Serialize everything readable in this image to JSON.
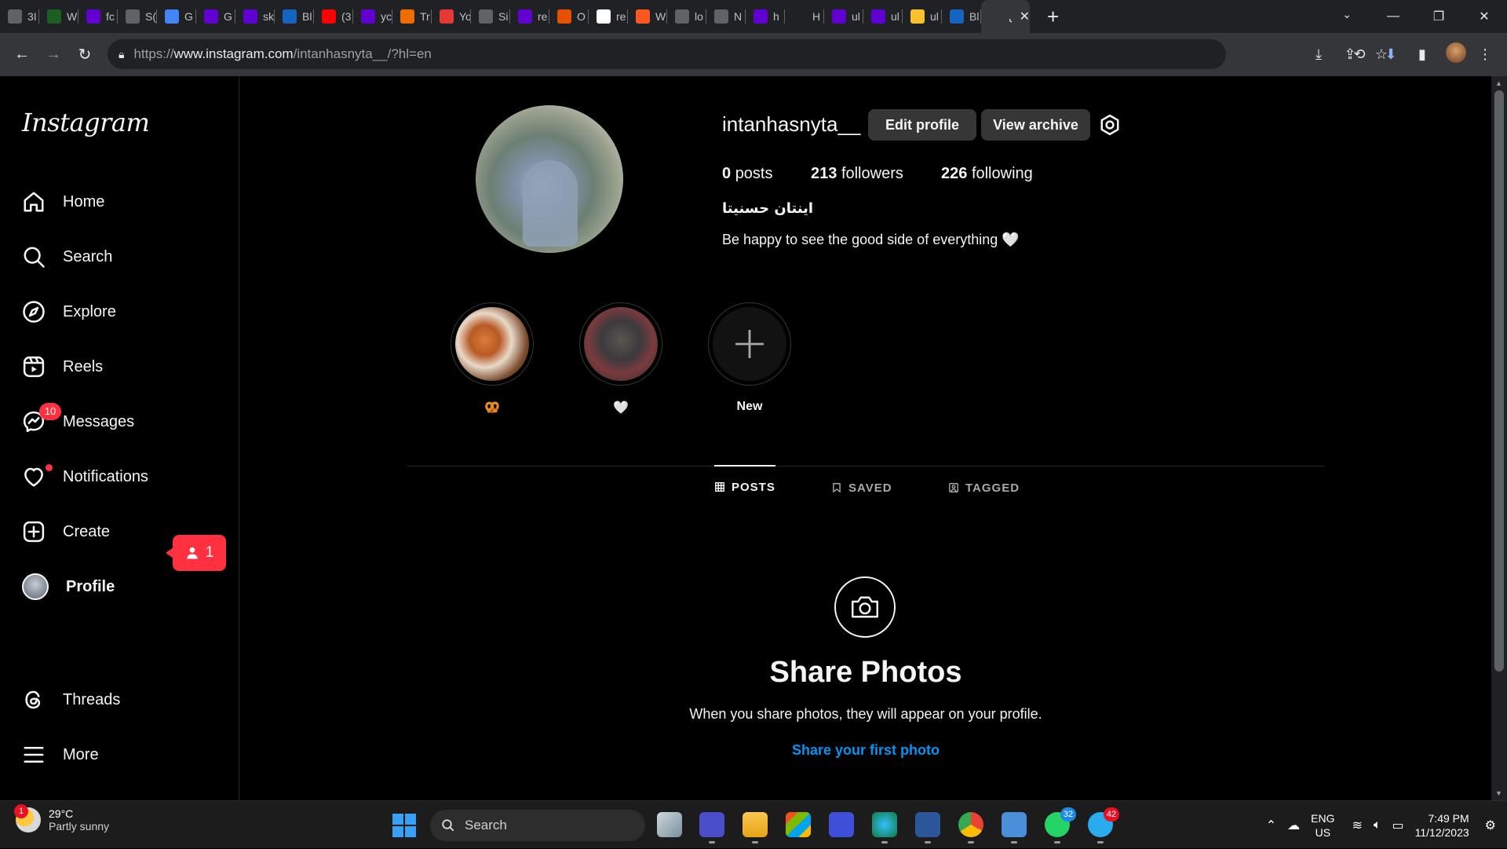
{
  "browser": {
    "tabs": [
      {
        "title": "3I",
        "icon": "globe-icon",
        "color": "#5f6368"
      },
      {
        "title": "W",
        "icon": "w-icon",
        "color": "#1b5e20"
      },
      {
        "title": "fc",
        "icon": "yahoo-icon",
        "color": "#6001d2"
      },
      {
        "title": "S(",
        "icon": "globe-icon",
        "color": "#5f6368"
      },
      {
        "title": "G",
        "icon": "translate-icon",
        "color": "#4285f4"
      },
      {
        "title": "G",
        "icon": "yahoo-icon",
        "color": "#6001d2"
      },
      {
        "title": "sk",
        "icon": "yahoo-icon",
        "color": "#6001d2"
      },
      {
        "title": "Bl",
        "icon": "grid-icon",
        "color": "#1565c0"
      },
      {
        "title": "(3",
        "icon": "youtube-icon",
        "color": "#ff0000"
      },
      {
        "title": "yc",
        "icon": "yahoo-icon",
        "color": "#6001d2"
      },
      {
        "title": "Tr",
        "icon": "chart-icon",
        "color": "#ef6c00"
      },
      {
        "title": "Yo",
        "icon": "download-icon",
        "color": "#e53935"
      },
      {
        "title": "Si",
        "icon": "globe-icon",
        "color": "#5f6368"
      },
      {
        "title": "re",
        "icon": "yahoo-icon",
        "color": "#6001d2"
      },
      {
        "title": "O",
        "icon": "e-icon",
        "color": "#e65100"
      },
      {
        "title": "re",
        "icon": "r-icon",
        "color": "#ffffff"
      },
      {
        "title": "W",
        "icon": "blogger-icon",
        "color": "#ff5722"
      },
      {
        "title": "lo",
        "icon": "globe-icon",
        "color": "#5f6368"
      },
      {
        "title": "N",
        "icon": "globe-icon",
        "color": "#5f6368"
      },
      {
        "title": "h",
        "icon": "yahoo-icon",
        "color": "#6001d2"
      },
      {
        "title": "H",
        "icon": "a-icon",
        "color": "#202124"
      },
      {
        "title": "ul",
        "icon": "yahoo-icon",
        "color": "#6001d2"
      },
      {
        "title": "ul",
        "icon": "yahoo-icon",
        "color": "#6001d2"
      },
      {
        "title": "ul",
        "icon": "check-icon",
        "color": "#fbc02d"
      },
      {
        "title": "Bl",
        "icon": "grid-icon",
        "color": "#1565c0"
      },
      {
        "title": "ال",
        "icon": "instagram-icon",
        "color": "#35363a",
        "active": true
      }
    ],
    "new_tab": "+",
    "url_prefix": "https://",
    "url_domain": "www.instagram.com",
    "url_path": "/intanhasnyta__/?hl=en"
  },
  "sidebar": {
    "logo": "Instagram",
    "items": [
      {
        "label": "Home",
        "icon": "home-icon"
      },
      {
        "label": "Search",
        "icon": "search-icon"
      },
      {
        "label": "Explore",
        "icon": "compass-icon"
      },
      {
        "label": "Reels",
        "icon": "reels-icon"
      },
      {
        "label": "Messages",
        "icon": "messenger-icon",
        "badge": "10"
      },
      {
        "label": "Notifications",
        "icon": "heart-icon",
        "pill": "1"
      },
      {
        "label": "Create",
        "icon": "plus-square-icon"
      },
      {
        "label": "Profile",
        "icon": "avatar"
      },
      {
        "label": "Threads",
        "icon": "threads-icon"
      },
      {
        "label": "More",
        "icon": "menu-icon"
      }
    ]
  },
  "profile": {
    "username": "intanhasnyta__",
    "edit_btn": "Edit profile",
    "archive_btn": "View archive",
    "posts_count": "0",
    "posts_label": "posts",
    "followers_count": "213",
    "followers_label": "followers",
    "following_count": "226",
    "following_label": "following",
    "full_name": "اينتان حسنيتا",
    "bio": "Be happy to see the good side of everything 🤍"
  },
  "highlights": [
    {
      "caption": "🥨"
    },
    {
      "caption": "🤍"
    },
    {
      "caption": "New"
    }
  ],
  "tabs": [
    {
      "label": "POSTS",
      "icon": "grid-icon",
      "active": true
    },
    {
      "label": "SAVED",
      "icon": "bookmark-icon"
    },
    {
      "label": "TAGGED",
      "icon": "tag-icon"
    }
  ],
  "empty_state": {
    "title": "Share Photos",
    "subtitle": "When you share photos, they will appear on your profile.",
    "link": "Share your first photo"
  },
  "taskbar": {
    "weather_temp": "29°C",
    "weather_desc": "Partly sunny",
    "weather_badge": "1",
    "search": "Search",
    "whatsapp_badge": "32",
    "telegram_badge": "42",
    "lang1": "ENG",
    "lang2": "US",
    "time": "7:49 PM",
    "date": "11/12/2023"
  }
}
